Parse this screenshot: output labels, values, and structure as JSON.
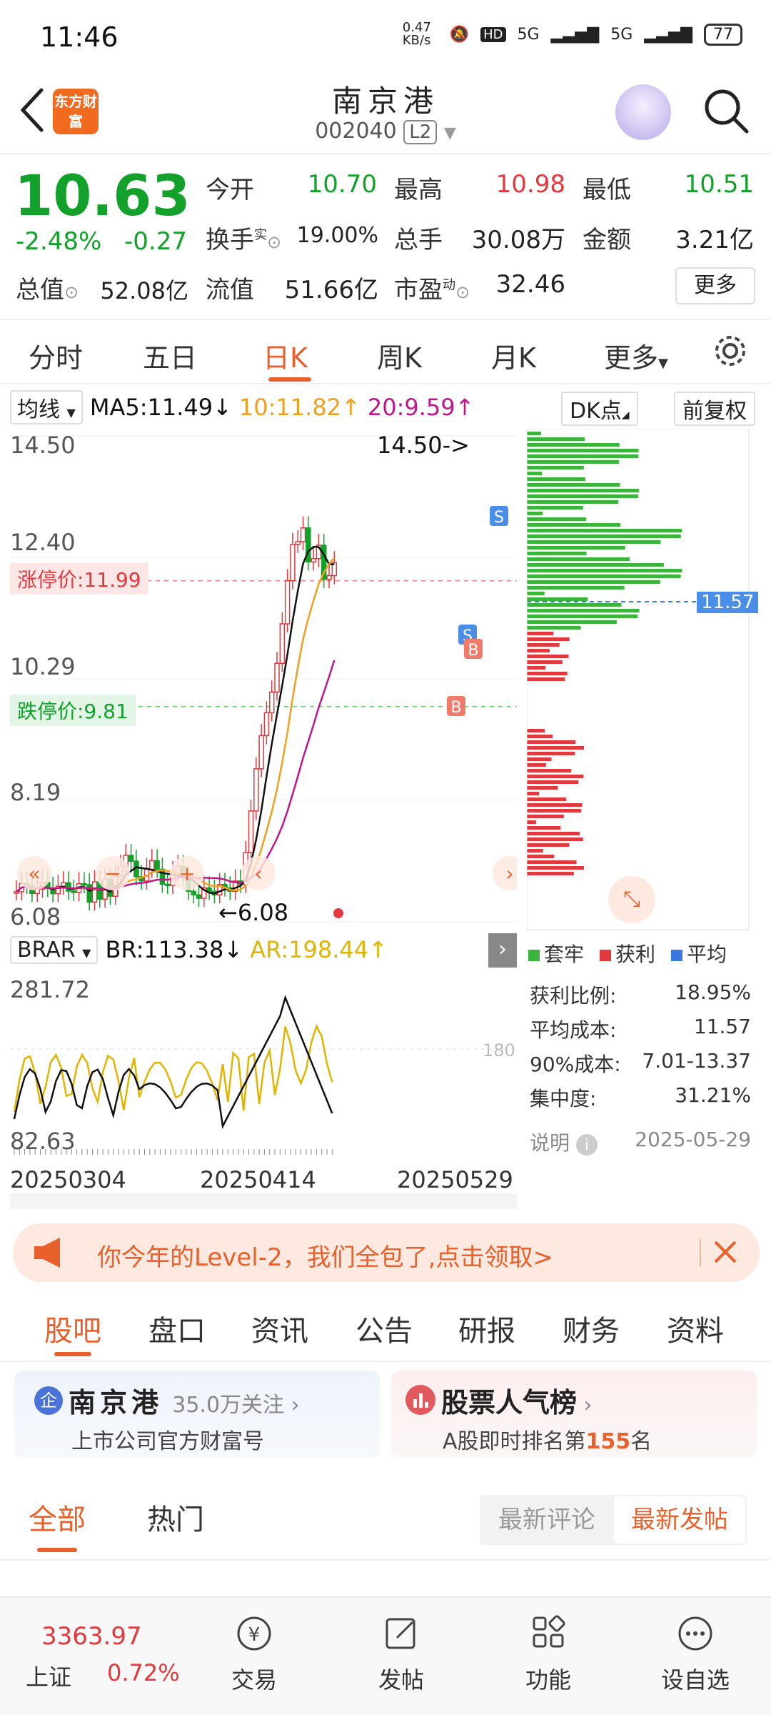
{
  "status": {
    "time": "11:46",
    "net_speed": "0.47 KB/s",
    "signal1": "5G",
    "signal2": "5G",
    "battery": "77"
  },
  "header": {
    "name": "南京港",
    "code": "002040",
    "level": "L2",
    "brand": "东方财富"
  },
  "quote": {
    "price": "10.63",
    "change_pct": "-2.48%",
    "change": "-0.27",
    "open_label": "今开",
    "open": "10.70",
    "high_label": "最高",
    "high": "10.98",
    "low_label": "最低",
    "low": "10.51",
    "turnover_label": "换手",
    "turnover_sup": "实",
    "turnover": "19.00%",
    "volume_label": "总手",
    "volume": "30.08万",
    "amount_label": "金额",
    "amount": "3.21亿",
    "mcap_label": "总值",
    "mcap": "52.08亿",
    "float_label": "流值",
    "float": "51.66亿",
    "pe_label": "市盈",
    "pe_sup": "动",
    "pe": "32.46",
    "more": "更多"
  },
  "period_tabs": [
    "分时",
    "五日",
    "日K",
    "周K",
    "月K",
    "更多"
  ],
  "ma": {
    "selector": "均线",
    "ma5": "MA5:11.49",
    "ma10": "10:11.82",
    "ma20": "20:9.59",
    "dk": "DK点",
    "fq": "前复权"
  },
  "kchart": {
    "y_ticks": [
      "14.50",
      "12.40",
      "10.29",
      "8.19",
      "6.08"
    ],
    "limit_up": "涨停价:11.99",
    "limit_down": "跌停价:9.81",
    "high_marker": "14.50->",
    "low_marker": "←6.08",
    "chip_avg": "11.57"
  },
  "brar": {
    "selector": "BRAR",
    "br": "BR:113.38",
    "ar": "AR:198.44",
    "y_top": "281.72",
    "y_bottom": "82.63",
    "ref": "180"
  },
  "dates": [
    "20250304",
    "20250414",
    "20250529"
  ],
  "chip_legend": [
    "套牢",
    "获利",
    "平均"
  ],
  "chip_stats": [
    {
      "label": "获利比例:",
      "value": "18.95%"
    },
    {
      "label": "平均成本:",
      "value": "11.57"
    },
    {
      "label": "90%成本:",
      "value": "7.01-13.37"
    },
    {
      "label": "集中度:",
      "value": "31.21%"
    },
    {
      "label": "说明",
      "value": "2025-05-29"
    }
  ],
  "banner": {
    "text": "你今年的Level-2，我们全包了,点击领取>"
  },
  "sub_tabs": [
    "股吧",
    "盘口",
    "资讯",
    "公告",
    "研报",
    "财务",
    "资料"
  ],
  "cards": {
    "company": {
      "title": "南京港",
      "followers": "35.0万关注",
      "sub": "上市公司官方财富号"
    },
    "rank": {
      "title": "股票人气榜",
      "sub_pre": "A股即时排名第",
      "rank": "155",
      "sub_post": "名"
    }
  },
  "feed": {
    "tab_all": "全部",
    "tab_hot": "热门",
    "sort_comment": "最新评论",
    "sort_post": "最新发帖"
  },
  "bottom": {
    "index_value": "3363.97",
    "index_name": "上证",
    "index_pct": "0.72%",
    "nav": [
      "交易",
      "发帖",
      "功能",
      "设自选"
    ]
  },
  "colors": {
    "up": "#e0393e",
    "down": "#13a02b",
    "accent": "#e8602b",
    "ma5": "#111111",
    "ma10": "#f0a020",
    "ma20": "#c0168c"
  }
}
